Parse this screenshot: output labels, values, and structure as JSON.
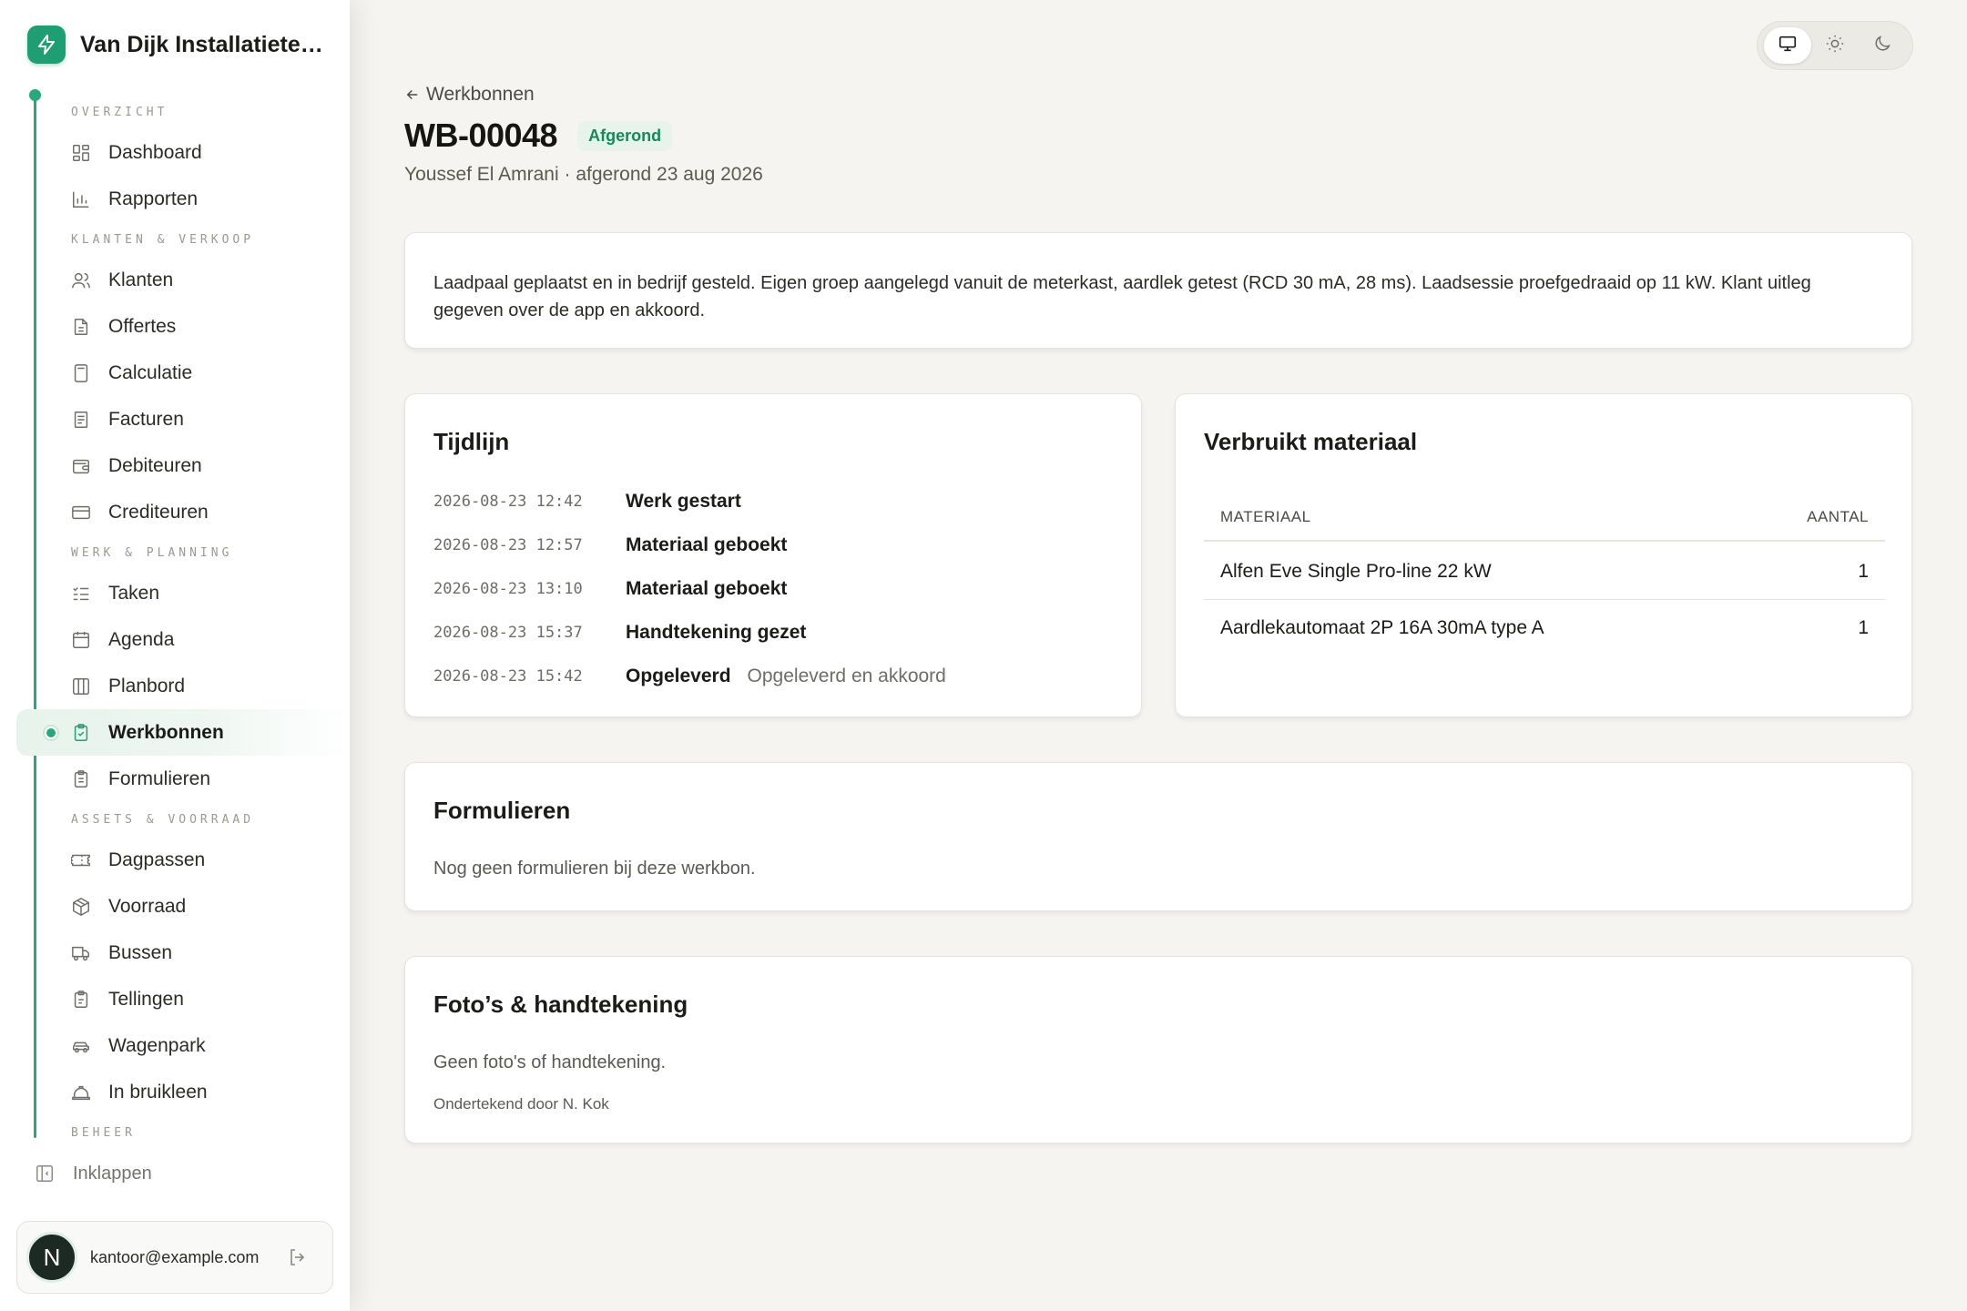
{
  "app": {
    "company_name": "Van Dijk Installatietechniek"
  },
  "sidebar": {
    "sections": [
      {
        "title": "OVERZICHT",
        "items": [
          {
            "label": "Dashboard",
            "icon": "dashboard-icon"
          },
          {
            "label": "Rapporten",
            "icon": "bar-chart-icon"
          }
        ]
      },
      {
        "title": "KLANTEN & VERKOOP",
        "items": [
          {
            "label": "Klanten",
            "icon": "users-icon"
          },
          {
            "label": "Offertes",
            "icon": "document-icon"
          },
          {
            "label": "Calculatie",
            "icon": "calculator-icon"
          },
          {
            "label": "Facturen",
            "icon": "receipt-icon"
          },
          {
            "label": "Debiteuren",
            "icon": "wallet-icon"
          },
          {
            "label": "Crediteuren",
            "icon": "credit-card-icon"
          }
        ]
      },
      {
        "title": "WERK & PLANNING",
        "items": [
          {
            "label": "Taken",
            "icon": "list-checks-icon"
          },
          {
            "label": "Agenda",
            "icon": "calendar-icon"
          },
          {
            "label": "Planbord",
            "icon": "columns-icon"
          },
          {
            "label": "Werkbonnen",
            "icon": "clipboard-check-icon",
            "active": true
          },
          {
            "label": "Formulieren",
            "icon": "clipboard-list-icon"
          }
        ]
      },
      {
        "title": "ASSETS & VOORRAAD",
        "items": [
          {
            "label": "Dagpassen",
            "icon": "ticket-icon"
          },
          {
            "label": "Voorraad",
            "icon": "package-icon"
          },
          {
            "label": "Bussen",
            "icon": "truck-icon"
          },
          {
            "label": "Tellingen",
            "icon": "clipboard-icon"
          },
          {
            "label": "Wagenpark",
            "icon": "car-icon"
          },
          {
            "label": "In bruikleen",
            "icon": "hard-hat-icon"
          }
        ]
      },
      {
        "title": "BEHEER",
        "items": []
      }
    ],
    "collapse_label": "Inklappen",
    "user": {
      "initial": "N",
      "email": "kantoor@example.com"
    }
  },
  "theme": {
    "options": [
      "system",
      "light",
      "dark"
    ],
    "selected": "system"
  },
  "page": {
    "back_label": "Werkbonnen",
    "title": "WB-00048",
    "status": "Afgerond",
    "subtitle": "Youssef El Amrani · afgerond 23 aug 2026",
    "description": "Laadpaal geplaatst en in bedrijf gesteld. Eigen groep aangelegd vanuit de meterkast, aardlek getest (RCD 30 mA, 28 ms). Laadsessie proefgedraaid op 11 kW. Klant uitleg gegeven over de app en akkoord."
  },
  "timeline": {
    "title": "Tijdlijn",
    "events": [
      {
        "time": "2026-08-23 12:42",
        "event": "Werk gestart",
        "note": ""
      },
      {
        "time": "2026-08-23 12:57",
        "event": "Materiaal geboekt",
        "note": ""
      },
      {
        "time": "2026-08-23 13:10",
        "event": "Materiaal geboekt",
        "note": ""
      },
      {
        "time": "2026-08-23 15:37",
        "event": "Handtekening gezet",
        "note": ""
      },
      {
        "time": "2026-08-23 15:42",
        "event": "Opgeleverd",
        "note": "Opgeleverd en akkoord"
      }
    ]
  },
  "materials": {
    "title": "Verbruikt materiaal",
    "columns": [
      "MATERIAAL",
      "AANTAL"
    ],
    "rows": [
      {
        "name": "Alfen Eve Single Pro-line 22 kW",
        "qty": "1"
      },
      {
        "name": "Aardlekautomaat 2P 16A 30mA type A",
        "qty": "1"
      }
    ]
  },
  "forms": {
    "title": "Formulieren",
    "empty": "Nog geen formulieren bij deze werkbon."
  },
  "photos": {
    "title": "Foto’s & handtekening",
    "empty": "Geen foto's of handtekening.",
    "signed_by": "Ondertekend door N. Kok"
  },
  "colors": {
    "accent": "#1f9e74",
    "background": "#f5f4f0",
    "badge_bg": "#e6f4ec",
    "badge_text": "#17875f"
  }
}
